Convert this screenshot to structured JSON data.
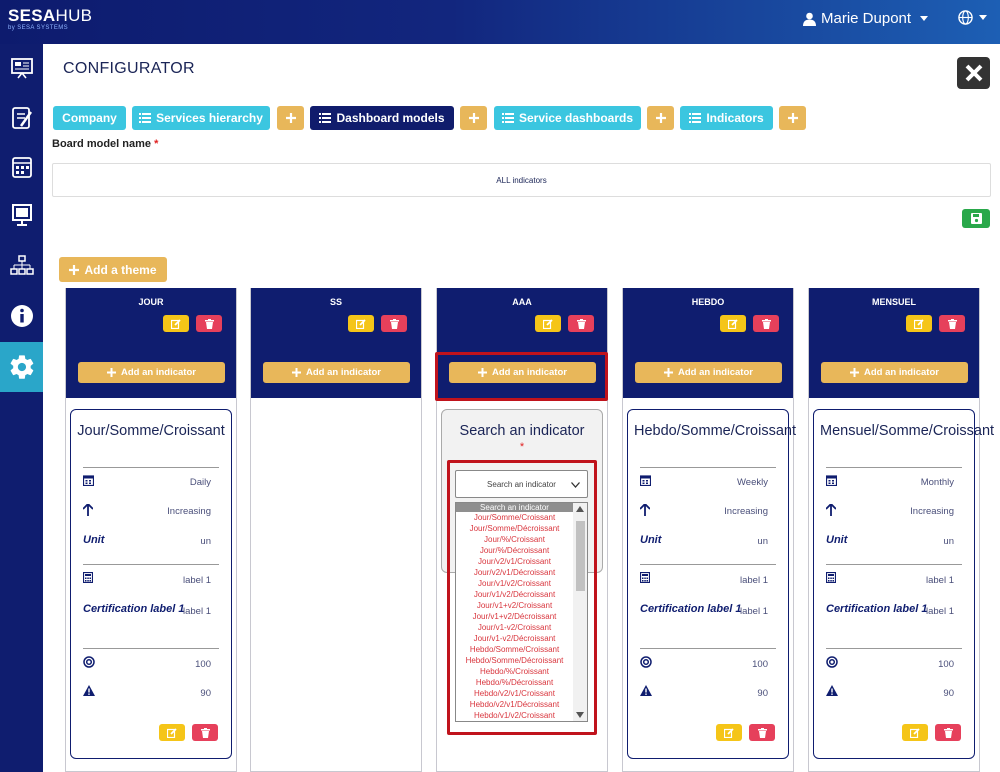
{
  "brand": {
    "name_bold": "SESA",
    "name_light": "HUB",
    "tagline": "by SESA SYSTEMS"
  },
  "header": {
    "user_name": "Marie Dupont"
  },
  "sidebar": {
    "items": [
      "presentation-board-icon",
      "checklist-icon",
      "calendar-grid-icon",
      "projector-icon",
      "hierarchy-icon",
      "info-icon",
      "gear-icon"
    ],
    "active_index": 6
  },
  "page": {
    "title": "CONFIGURATOR"
  },
  "nav": {
    "company": "Company",
    "services_hierarchy": "Services hierarchy",
    "dashboard_models": "Dashboard models",
    "service_dashboards": "Service dashboards",
    "indicators": "Indicators"
  },
  "form": {
    "board_model_label": "Board model name",
    "required_mark": "*",
    "board_model_value": "ALL indicators"
  },
  "buttons": {
    "add_theme": "Add a theme",
    "add_indicator": "Add an indicator"
  },
  "columns": [
    {
      "title": "JOUR",
      "card": {
        "title": "Jour/Somme/Croissant",
        "frequency": "Daily",
        "direction": "Increasing",
        "unit_label": "Unit",
        "unit_value": "un",
        "label_value": "label 1",
        "cert_label": "Certification label 1",
        "cert_value": "label 1",
        "target": "100",
        "alert": "90"
      }
    },
    {
      "title": "SS",
      "card": null
    },
    {
      "title": "AAA",
      "search": {
        "title": "Search an indicator",
        "placeholder": "Search an indicator"
      }
    },
    {
      "title": "HEBDO",
      "card": {
        "title": "Hebdo/Somme/Croissant",
        "frequency": "Weekly",
        "direction": "Increasing",
        "unit_label": "Unit",
        "unit_value": "un",
        "label_value": "label 1",
        "cert_label": "Certification label 1",
        "cert_value": "label 1",
        "target": "100",
        "alert": "90"
      }
    },
    {
      "title": "MENSUEL",
      "card": {
        "title": "Mensuel/Somme/Croissant",
        "frequency": "Monthly",
        "direction": "Increasing",
        "unit_label": "Unit",
        "unit_value": "un",
        "label_value": "label 1",
        "cert_label": "Certification label 1",
        "cert_value": "label 1",
        "target": "100",
        "alert": "90"
      }
    }
  ],
  "dropdown": {
    "options": [
      "Search an indicator",
      "Jour/Somme/Croissant",
      "Jour/Somme/Décroissant",
      "Jour/%/Croissant",
      "Jour/%/Décroissant",
      "Jour/v2/v1/Croissant",
      "Jour/v2/v1/Décroissant",
      "Jour/v1/v2/Croissant",
      "Jour/v1/v2/Décroissant",
      "Jour/v1+v2/Croissant",
      "Jour/v1+v2/Décroissant",
      "Jour/v1-v2/Croissant",
      "Jour/v1-v2/Décroissant",
      "Hebdo/Somme/Croissant",
      "Hebdo/Somme/Décroissant",
      "Hebdo/%/Croissant",
      "Hebdo/%/Décroissant",
      "Hebdo/v2/v1/Croissant",
      "Hebdo/v2/v1/Décroissant",
      "Hebdo/v1/v2/Croissant"
    ],
    "selected_index": 0
  },
  "colors": {
    "navy": "#0f1d6f",
    "cyan": "#3bc6e0",
    "gold": "#e8b75a",
    "yellow": "#f5c518",
    "red": "#e6405b",
    "green": "#29a84a",
    "highlight": "#c0131c"
  }
}
